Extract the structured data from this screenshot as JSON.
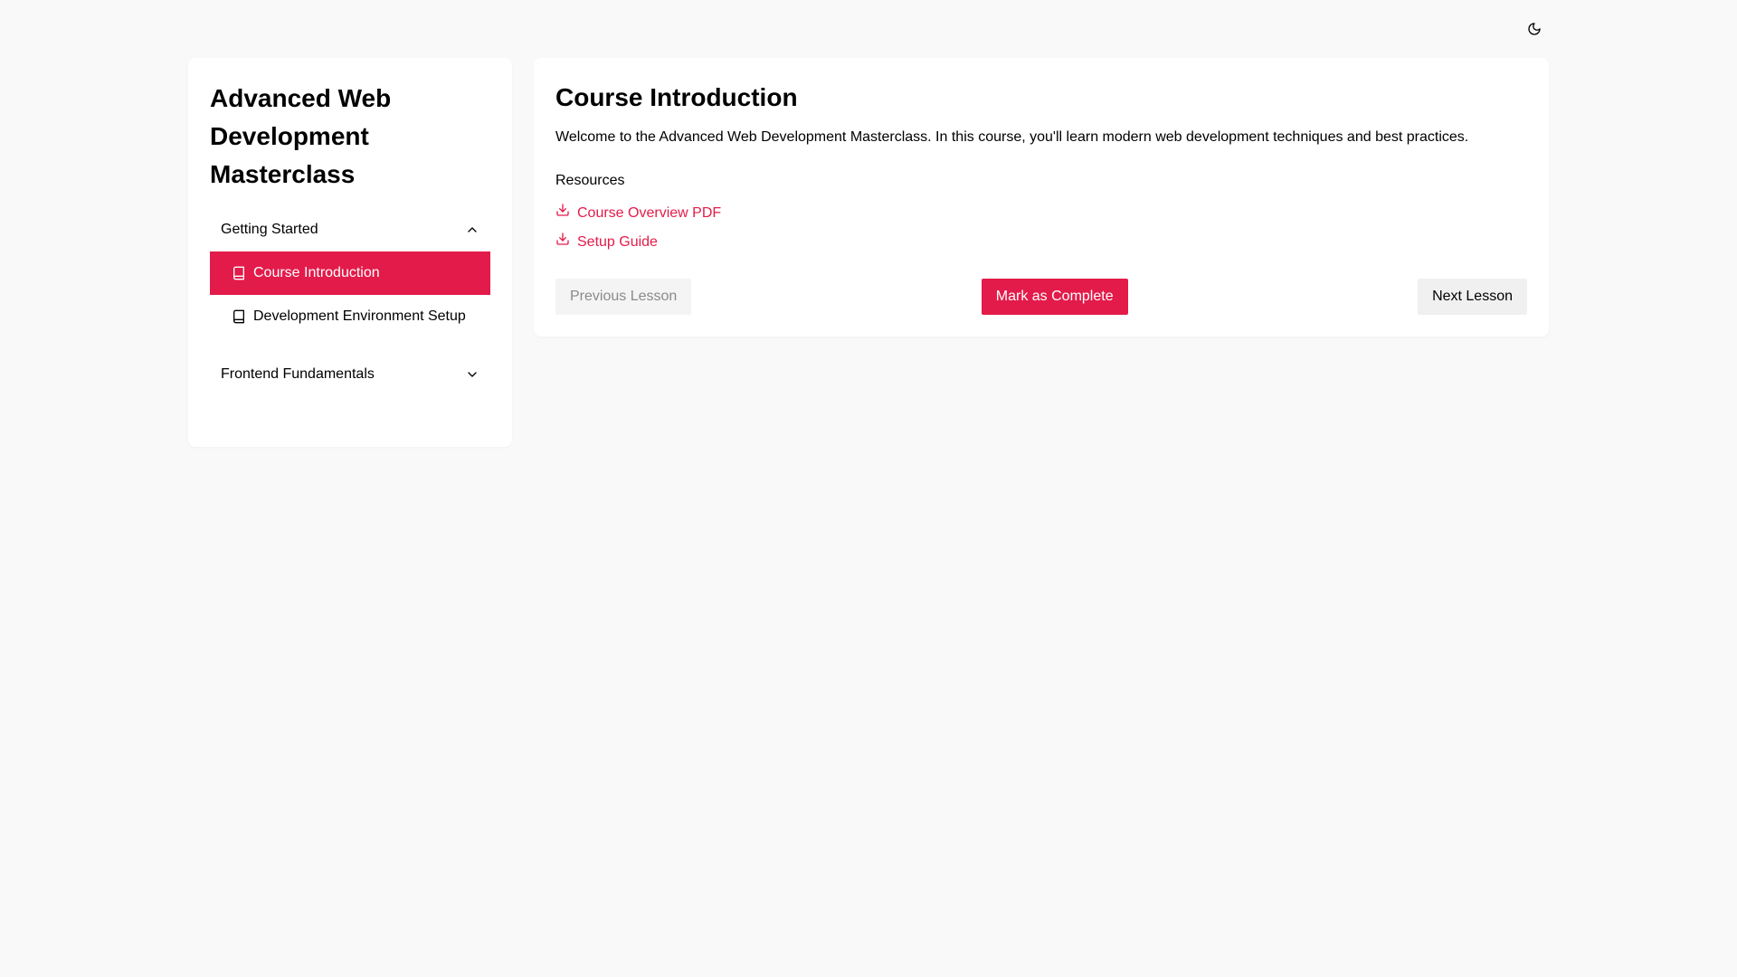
{
  "theme_toggle": {
    "icon": "moon-icon"
  },
  "sidebar": {
    "course_title": "Advanced Web Development Masterclass",
    "modules": [
      {
        "title": "Getting Started",
        "expanded": true,
        "lessons": [
          {
            "title": "Course Introduction",
            "active": true,
            "icon": "book-icon"
          },
          {
            "title": "Development Environment Setup",
            "active": false,
            "icon": "book-icon"
          }
        ]
      },
      {
        "title": "Frontend Fundamentals",
        "expanded": false,
        "lessons": []
      }
    ]
  },
  "main": {
    "title": "Course Introduction",
    "description": "Welcome to the Advanced Web Development Masterclass. In this course, you'll learn modern web development techniques and best practices.",
    "resources_heading": "Resources",
    "resources": [
      {
        "label": "Course Overview PDF",
        "icon": "download-icon"
      },
      {
        "label": "Setup Guide",
        "icon": "download-icon"
      }
    ],
    "buttons": {
      "previous": "Previous Lesson",
      "complete": "Mark as Complete",
      "next": "Next Lesson"
    }
  },
  "colors": {
    "accent": "#e31b4a",
    "background": "#f9f9f9",
    "card": "#ffffff"
  }
}
